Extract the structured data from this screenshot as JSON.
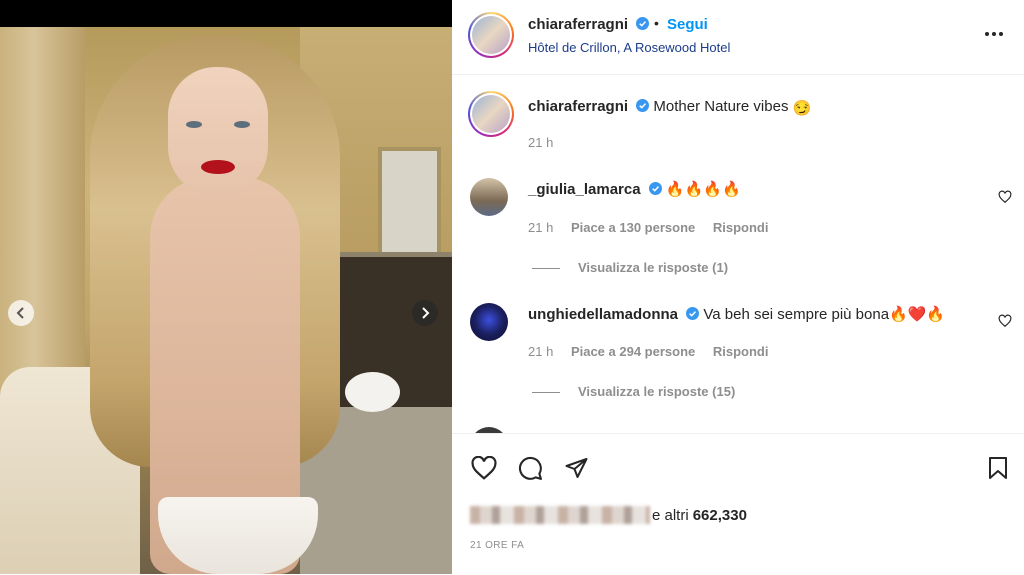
{
  "post": {
    "username": "chiaraferragni",
    "follow_label": "Segui",
    "separator": "•",
    "location": "Hôtel de Crillon, A Rosewood Hotel"
  },
  "caption": {
    "username": "chiaraferragni",
    "text": "Mother Nature vibes",
    "emoji": "😏",
    "age": "21 h"
  },
  "comments": [
    {
      "username": "_giulia_lamarca",
      "text": "🔥🔥🔥🔥",
      "age": "21 h",
      "likes": "Piace a 130 persone",
      "reply_label": "Rispondi",
      "view_replies": "Visualizza le risposte (1)"
    },
    {
      "username": "unghiedellamadonna",
      "text": "Va beh sei sempre più bona🔥❤️🔥",
      "age": "21 h",
      "likes": "Piace a 294 persone",
      "reply_label": "Rispondi",
      "view_replies": "Visualizza le risposte (15)"
    }
  ],
  "footer": {
    "likes_suffix": "e altri",
    "likes_count": "662,330",
    "timestamp": "21 ORE FA"
  },
  "colors": {
    "follow": "#0095f6",
    "location": "#1c3c8a",
    "verified": "#3897f0",
    "muted": "#8e8e8e"
  },
  "icons": {
    "carousel_prev": "chevron-left-icon",
    "carousel_next": "chevron-right-icon",
    "more": "more-horizontal-icon",
    "verified": "verified-badge-icon",
    "comment_like": "heart-outline-icon",
    "like": "heart-outline-icon",
    "comment": "comment-bubble-icon",
    "share": "paper-plane-icon",
    "save": "bookmark-icon"
  }
}
